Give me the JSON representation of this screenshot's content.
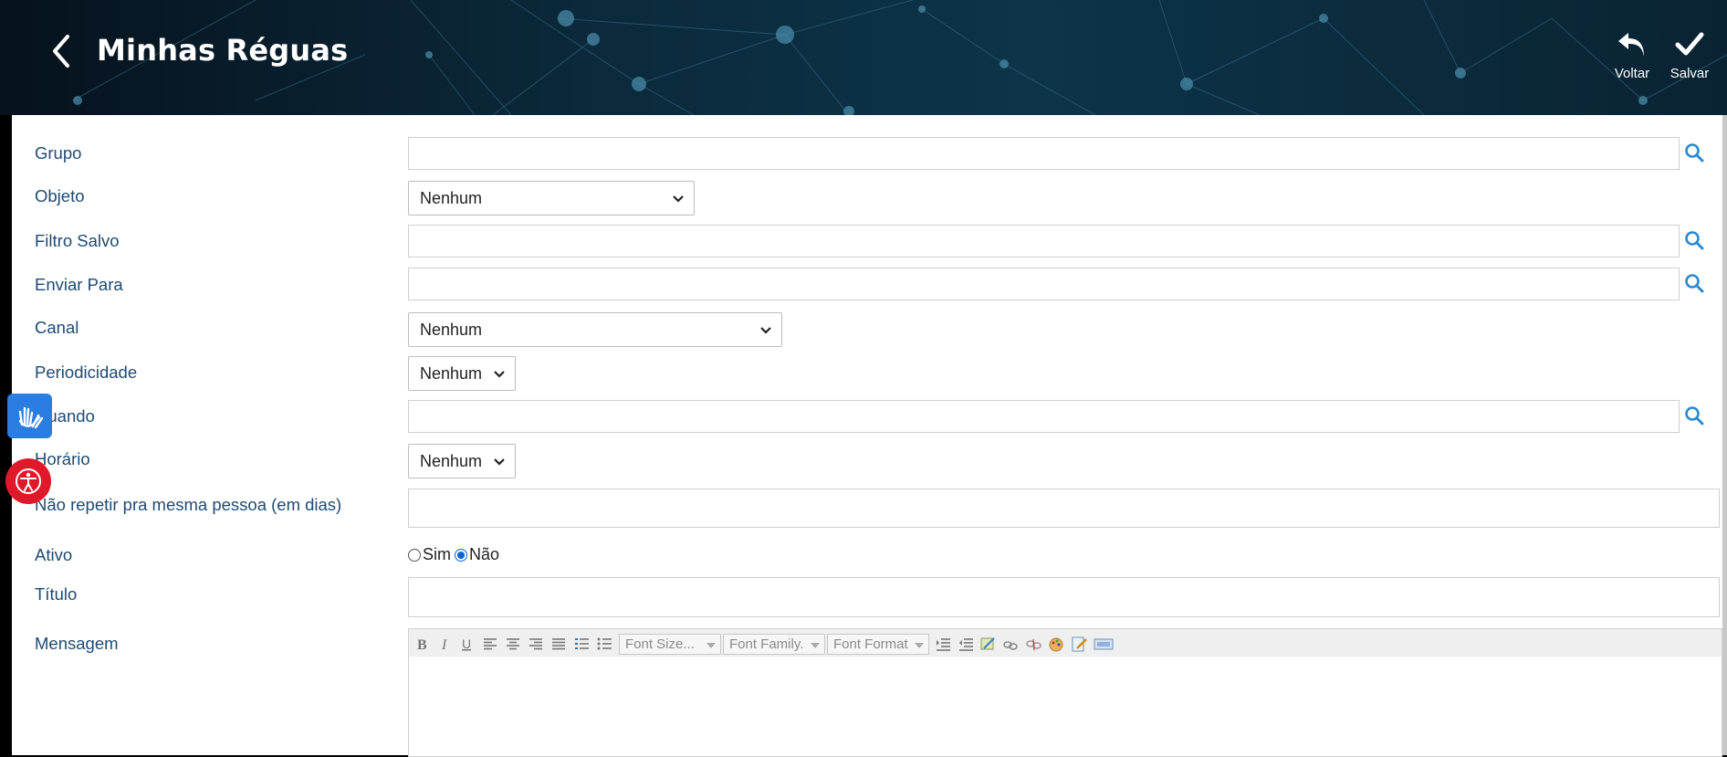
{
  "header": {
    "title": "Minhas Réguas",
    "back_icon": "chevron-left-icon",
    "actions": [
      {
        "label": "Voltar",
        "icon": "undo-arrow-icon"
      },
      {
        "label": "Salvar",
        "icon": "checkmark-icon"
      }
    ]
  },
  "form": {
    "grupo": {
      "label": "Grupo",
      "value": ""
    },
    "objeto": {
      "label": "Objeto",
      "value": "Nenhum"
    },
    "filtro_salvo": {
      "label": "Filtro Salvo",
      "value": ""
    },
    "enviar_para": {
      "label": "Enviar Para",
      "value": ""
    },
    "canal": {
      "label": "Canal",
      "value": "Nenhum"
    },
    "periodicidade": {
      "label": "Periodicidade",
      "value": "Nenhum"
    },
    "quando": {
      "label": "Quando",
      "value": ""
    },
    "horario": {
      "label": "Horário",
      "value": "Nenhum"
    },
    "nao_repetir": {
      "label": "Não repetir pra mesma pessoa (em dias)",
      "value": ""
    },
    "ativo": {
      "label": "Ativo",
      "option_sim": "Sim",
      "option_nao": "Não",
      "selected": "Não"
    },
    "titulo": {
      "label": "Título",
      "value": ""
    },
    "mensagem": {
      "label": "Mensagem",
      "value": ""
    }
  },
  "editor_toolbar": {
    "font_size": "Font Size...",
    "font_family": "Font Family.",
    "font_format": "Font Format"
  },
  "colors": {
    "label": "#1e4a73",
    "accent": "#2a8bd1",
    "hands_button": "#2a7de1",
    "accessibility_button": "#e0192a"
  }
}
